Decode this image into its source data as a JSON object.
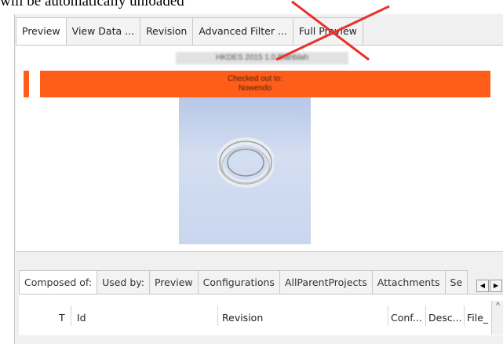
{
  "caption": "will be automatically unloaded",
  "top_tabs": [
    "Preview",
    "View Data ...",
    "Revision",
    "Advanced Filter ...",
    "Full Preview"
  ],
  "preview": {
    "header_text": "HKDES 2015 1.0 Blahblah",
    "banner_line1": "Checked out to:",
    "banner_line2": "Nowendo",
    "banner_color": "#ff5e1a"
  },
  "bottom_tabs": [
    "Composed of:",
    "Used by:",
    "Preview",
    "Configurations",
    "AllParentProjects",
    "Attachments",
    "Se"
  ],
  "scroll_buttons": {
    "left": "◀",
    "right": "▶"
  },
  "grid_columns": [
    "T",
    "Id",
    "Revision",
    "Conf...",
    "Desc...",
    "File_"
  ],
  "scroll_up": "^",
  "icons": [
    "red-cross-overlay-icon",
    "ring-part-thumbnail-icon",
    "scroll-left-icon",
    "scroll-right-icon",
    "scroll-up-icon"
  ]
}
